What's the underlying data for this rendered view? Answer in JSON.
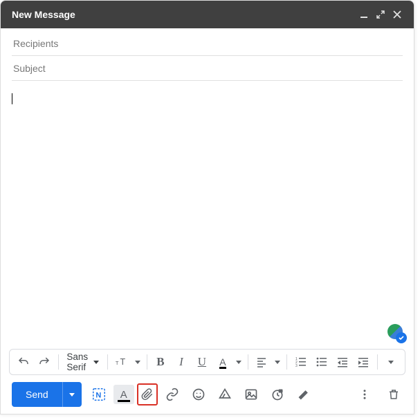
{
  "title": "New Message",
  "fields": {
    "recipients_placeholder": "Recipients",
    "recipients_value": "",
    "subject_placeholder": "Subject",
    "subject_value": ""
  },
  "body_text": "",
  "format": {
    "font_name": "Sans Serif"
  },
  "actions": {
    "send_label": "Send"
  }
}
